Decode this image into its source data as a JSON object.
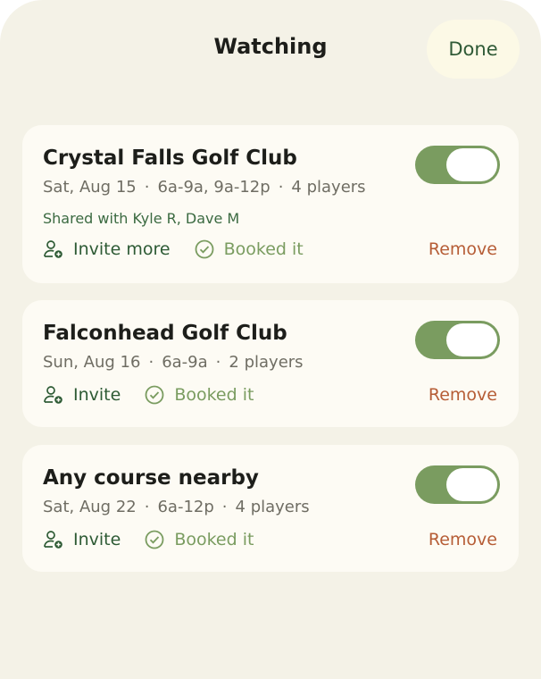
{
  "header": {
    "title": "Watching",
    "done_label": "Done"
  },
  "colors": {
    "background": "#f4f2e7",
    "card": "#fdfbf4",
    "accent_green": "#7a9c60",
    "dark_green": "#2d5a34",
    "remove_orange": "#b65d36"
  },
  "watches": [
    {
      "course": "Crystal Falls Golf Club",
      "date": "Sat, Aug 15",
      "times": "6a-9a, 9a-12p",
      "players": "4 players",
      "shared": "Shared with Kyle R, Dave M",
      "invite_label": "Invite more",
      "booked_label": "Booked it",
      "remove_label": "Remove",
      "enabled": true
    },
    {
      "course": "Falconhead Golf Club",
      "date": "Sun, Aug 16",
      "times": "6a-9a",
      "players": "2 players",
      "invite_label": "Invite",
      "booked_label": "Booked it",
      "remove_label": "Remove",
      "enabled": true
    },
    {
      "course": "Any course nearby",
      "date": "Sat, Aug 22",
      "times": "6a-12p",
      "players": "4 players",
      "invite_label": "Invite",
      "booked_label": "Booked it",
      "remove_label": "Remove",
      "enabled": true
    }
  ],
  "icons": {
    "invite": "add-person-icon",
    "booked": "check-circle-icon"
  }
}
